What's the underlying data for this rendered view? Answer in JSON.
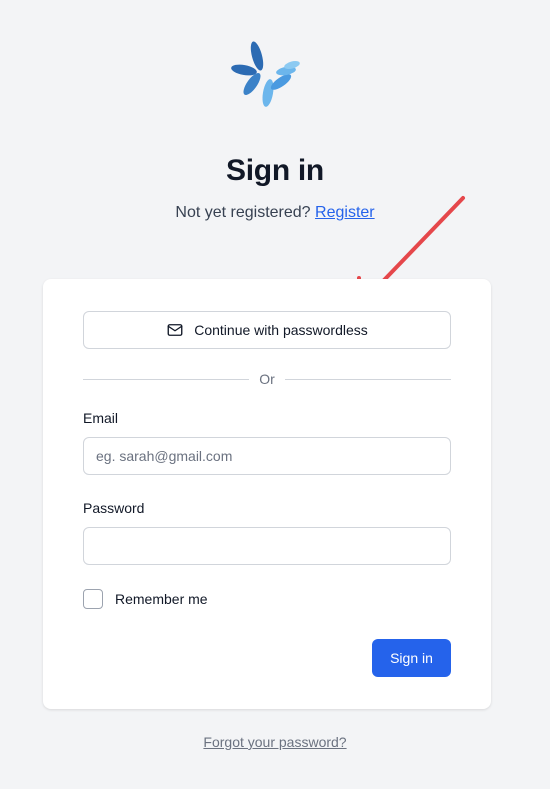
{
  "header": {
    "logo_icon": "flower-logo-icon",
    "title": "Sign in",
    "prompt": "Not yet registered?",
    "register_link": "Register"
  },
  "card": {
    "passwordless_button": "Continue with passwordless",
    "passwordless_icon": "mail-icon",
    "divider_text": "Or",
    "email": {
      "label": "Email",
      "placeholder": "eg. sarah@gmail.com",
      "value": ""
    },
    "password": {
      "label": "Password",
      "value": ""
    },
    "remember_me": {
      "label": "Remember me",
      "checked": false
    },
    "submit_button": "Sign in"
  },
  "footer": {
    "forgot_link": "Forgot your password?"
  },
  "colors": {
    "background": "#f3f4f6",
    "primary": "#2563eb",
    "annotation_arrow": "#e5474b",
    "logo_dark": "#2c6bb3",
    "logo_light": "#6cb6ec"
  }
}
